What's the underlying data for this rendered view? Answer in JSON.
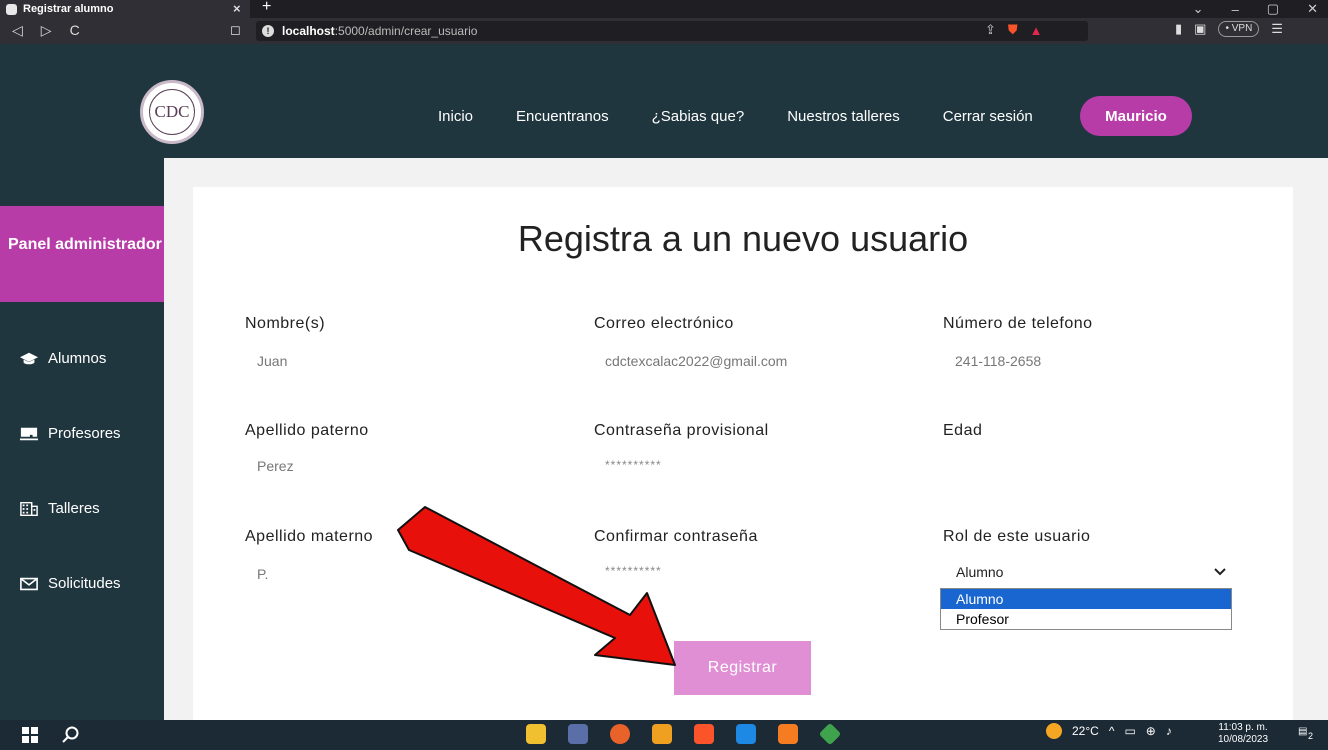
{
  "browser": {
    "tab_title": "Registrar alumno",
    "close_tab": "×",
    "new_tab": "+",
    "window_controls": [
      "⌄",
      "–",
      "▢",
      "✕"
    ],
    "nav": [
      "◁",
      "▷",
      "C"
    ],
    "url_host": "localhost",
    "url_path": ":5000/admin/crear_usuario",
    "vpn_label": "• VPN"
  },
  "site": {
    "logo_text": "CDC",
    "nav_items": [
      "Inicio",
      "Encuentranos",
      "¿Sabias que?",
      "Nuestros talleres",
      "Cerrar sesión"
    ],
    "user_name": "Mauricio"
  },
  "sidebar": {
    "title": "Panel administrador",
    "items": [
      {
        "label": "Alumnos",
        "icon": "graduation-cap-icon"
      },
      {
        "label": "Profesores",
        "icon": "chalkboard-icon"
      },
      {
        "label": "Talleres",
        "icon": "building-icon"
      },
      {
        "label": "Solicitudes",
        "icon": "envelope-icon"
      }
    ]
  },
  "form": {
    "title": "Registra a un nuevo usuario",
    "nombre": {
      "label": "Nombre(s)",
      "value": "Juan"
    },
    "correo": {
      "label": "Correo electrónico",
      "value": "cdctexcalac2022@gmail.com"
    },
    "telefono": {
      "label": "Número de telefono",
      "value": "241-118-2658"
    },
    "apellido_paterno": {
      "label": "Apellido paterno",
      "value": "Perez"
    },
    "contrasena": {
      "label": "Contraseña provisional",
      "value": "**********"
    },
    "edad": {
      "label": "Edad",
      "value": ""
    },
    "apellido_materno": {
      "label": "Apellido materno",
      "value": "P."
    },
    "confirmar": {
      "label": "Confirmar contraseña",
      "value": "**********"
    },
    "rol": {
      "label": "Rol de este usuario",
      "value": "Alumno",
      "options": [
        "Alumno",
        "Profesor"
      ]
    },
    "submit_label": "Registrar"
  },
  "taskbar": {
    "weather": "22°C",
    "time": "11:03 p. m.",
    "date": "10/08/2023",
    "notifications": "2"
  },
  "colors": {
    "header_bg": "#20363f",
    "accent": "#b73ca7",
    "button_pink": "#e08fd4",
    "arrow_red": "#e8100a"
  }
}
